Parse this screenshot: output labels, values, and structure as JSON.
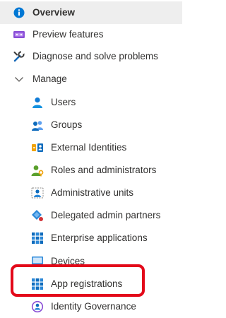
{
  "nav": {
    "overview": {
      "label": "Overview",
      "icon": "info-icon"
    },
    "preview_features": {
      "label": "Preview features",
      "icon": "preview-features-icon"
    },
    "diagnose": {
      "label": "Diagnose and solve problems",
      "icon": "wrench-icon"
    },
    "manage": {
      "label": "Manage",
      "icon": "chevron-down-icon",
      "expanded": true
    },
    "manage_items": [
      {
        "label": "Users",
        "icon": "user-icon"
      },
      {
        "label": "Groups",
        "icon": "groups-icon"
      },
      {
        "label": "External Identities",
        "icon": "external-identities-icon"
      },
      {
        "label": "Roles and administrators",
        "icon": "roles-icon"
      },
      {
        "label": "Administrative units",
        "icon": "administrative-units-icon"
      },
      {
        "label": "Delegated admin partners",
        "icon": "delegated-admin-icon"
      },
      {
        "label": "Enterprise applications",
        "icon": "enterprise-apps-icon"
      },
      {
        "label": "Devices",
        "icon": "devices-icon"
      },
      {
        "label": "App registrations",
        "icon": "app-registrations-icon"
      },
      {
        "label": "Identity Governance",
        "icon": "identity-governance-icon"
      }
    ]
  },
  "colors": {
    "selected_bg": "#eeeeee",
    "highlight": "#e3091a",
    "azure_blue": "#0078d4",
    "text": "#323130"
  }
}
